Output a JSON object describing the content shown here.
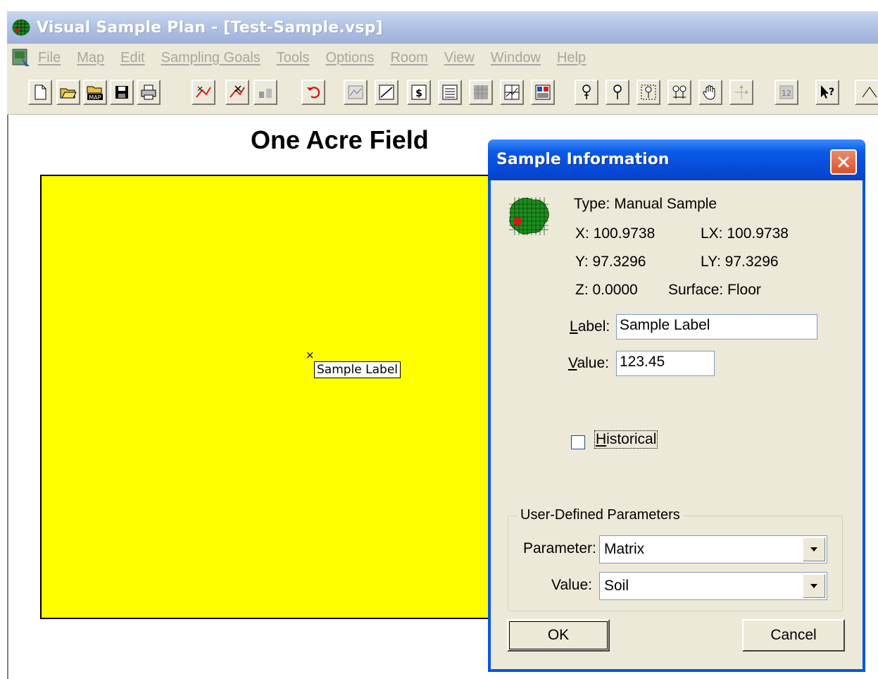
{
  "window": {
    "title": "Visual Sample Plan - [Test-Sample.vsp]"
  },
  "menu": {
    "items": [
      "File",
      "Map",
      "Edit",
      "Sampling Goals",
      "Tools",
      "Options",
      "Room",
      "View",
      "Window",
      "Help"
    ]
  },
  "toolbar": {
    "icons": [
      "new-file-icon",
      "open-folder-icon",
      "open-map-icon",
      "save-icon",
      "print-icon",
      "draw-sample-icon",
      "remove-sample-icon",
      "sample-tool-icon",
      "undo-icon",
      "map-view-icon",
      "graph-view-icon",
      "cost-view-icon",
      "report-view-icon",
      "grid-view-icon",
      "coordinate-view-icon",
      "multi-view-icon",
      "pin-icon",
      "pin-alt-icon",
      "pin-box-icon",
      "multi-pin-icon",
      "pan-hand-icon",
      "rotate-icon",
      "zoom-box-icon",
      "help-pointer-icon",
      "partial-icon"
    ]
  },
  "map": {
    "title": "One Acre Field",
    "sample_marker": "×",
    "sample_label": "Sample Label",
    "field_color": "#ffff00"
  },
  "dialog": {
    "title": "Sample Information",
    "type_text": "Type: Manual Sample",
    "x_text": "X: 100.9738",
    "lx_text": "LX: 100.9738",
    "y_text": "Y: 97.3296",
    "ly_text": "LY: 97.3296",
    "z_text": "Z: 0.0000",
    "surface_text": "Surface: Floor",
    "label_caption_first": "L",
    "label_caption_rest": "abel:",
    "label_value": "Sample Label",
    "value_caption_first": "V",
    "value_caption_rest": "alue:",
    "value_value": "123.45",
    "historical_first": "H",
    "historical_rest": "istorical",
    "historical_checked": false,
    "group_title": "User-Defined Parameters",
    "parameter_caption": "Parameter:",
    "parameter_value": "Matrix",
    "udp_value_caption": "Value:",
    "udp_value_value": "Soil",
    "ok_label": "OK",
    "cancel_label": "Cancel"
  }
}
